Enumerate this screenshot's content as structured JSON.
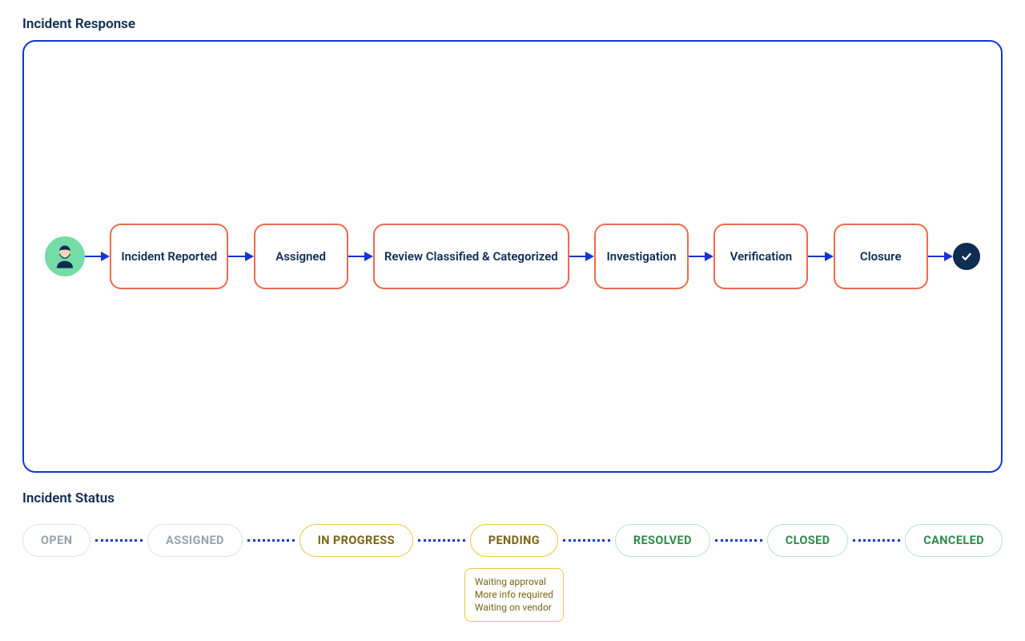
{
  "response": {
    "title": "Incident Response",
    "steps": [
      "Incident Reported",
      "Assigned",
      "Review Classified & Categorized",
      "Investigation",
      "Verification",
      "Closure"
    ]
  },
  "status": {
    "title": "Incident Status",
    "pills": [
      {
        "label": "OPEN",
        "style": "gray"
      },
      {
        "label": "ASSIGNED",
        "style": "gray"
      },
      {
        "label": "IN PROGRESS",
        "style": "yellow"
      },
      {
        "label": "PENDING",
        "style": "yellow",
        "details": [
          "Waiting approval",
          "More info required",
          "Waiting on vendor"
        ]
      },
      {
        "label": "RESOLVED",
        "style": "green"
      },
      {
        "label": "CLOSED",
        "style": "green"
      },
      {
        "label": "CANCELED",
        "style": "green"
      }
    ]
  }
}
